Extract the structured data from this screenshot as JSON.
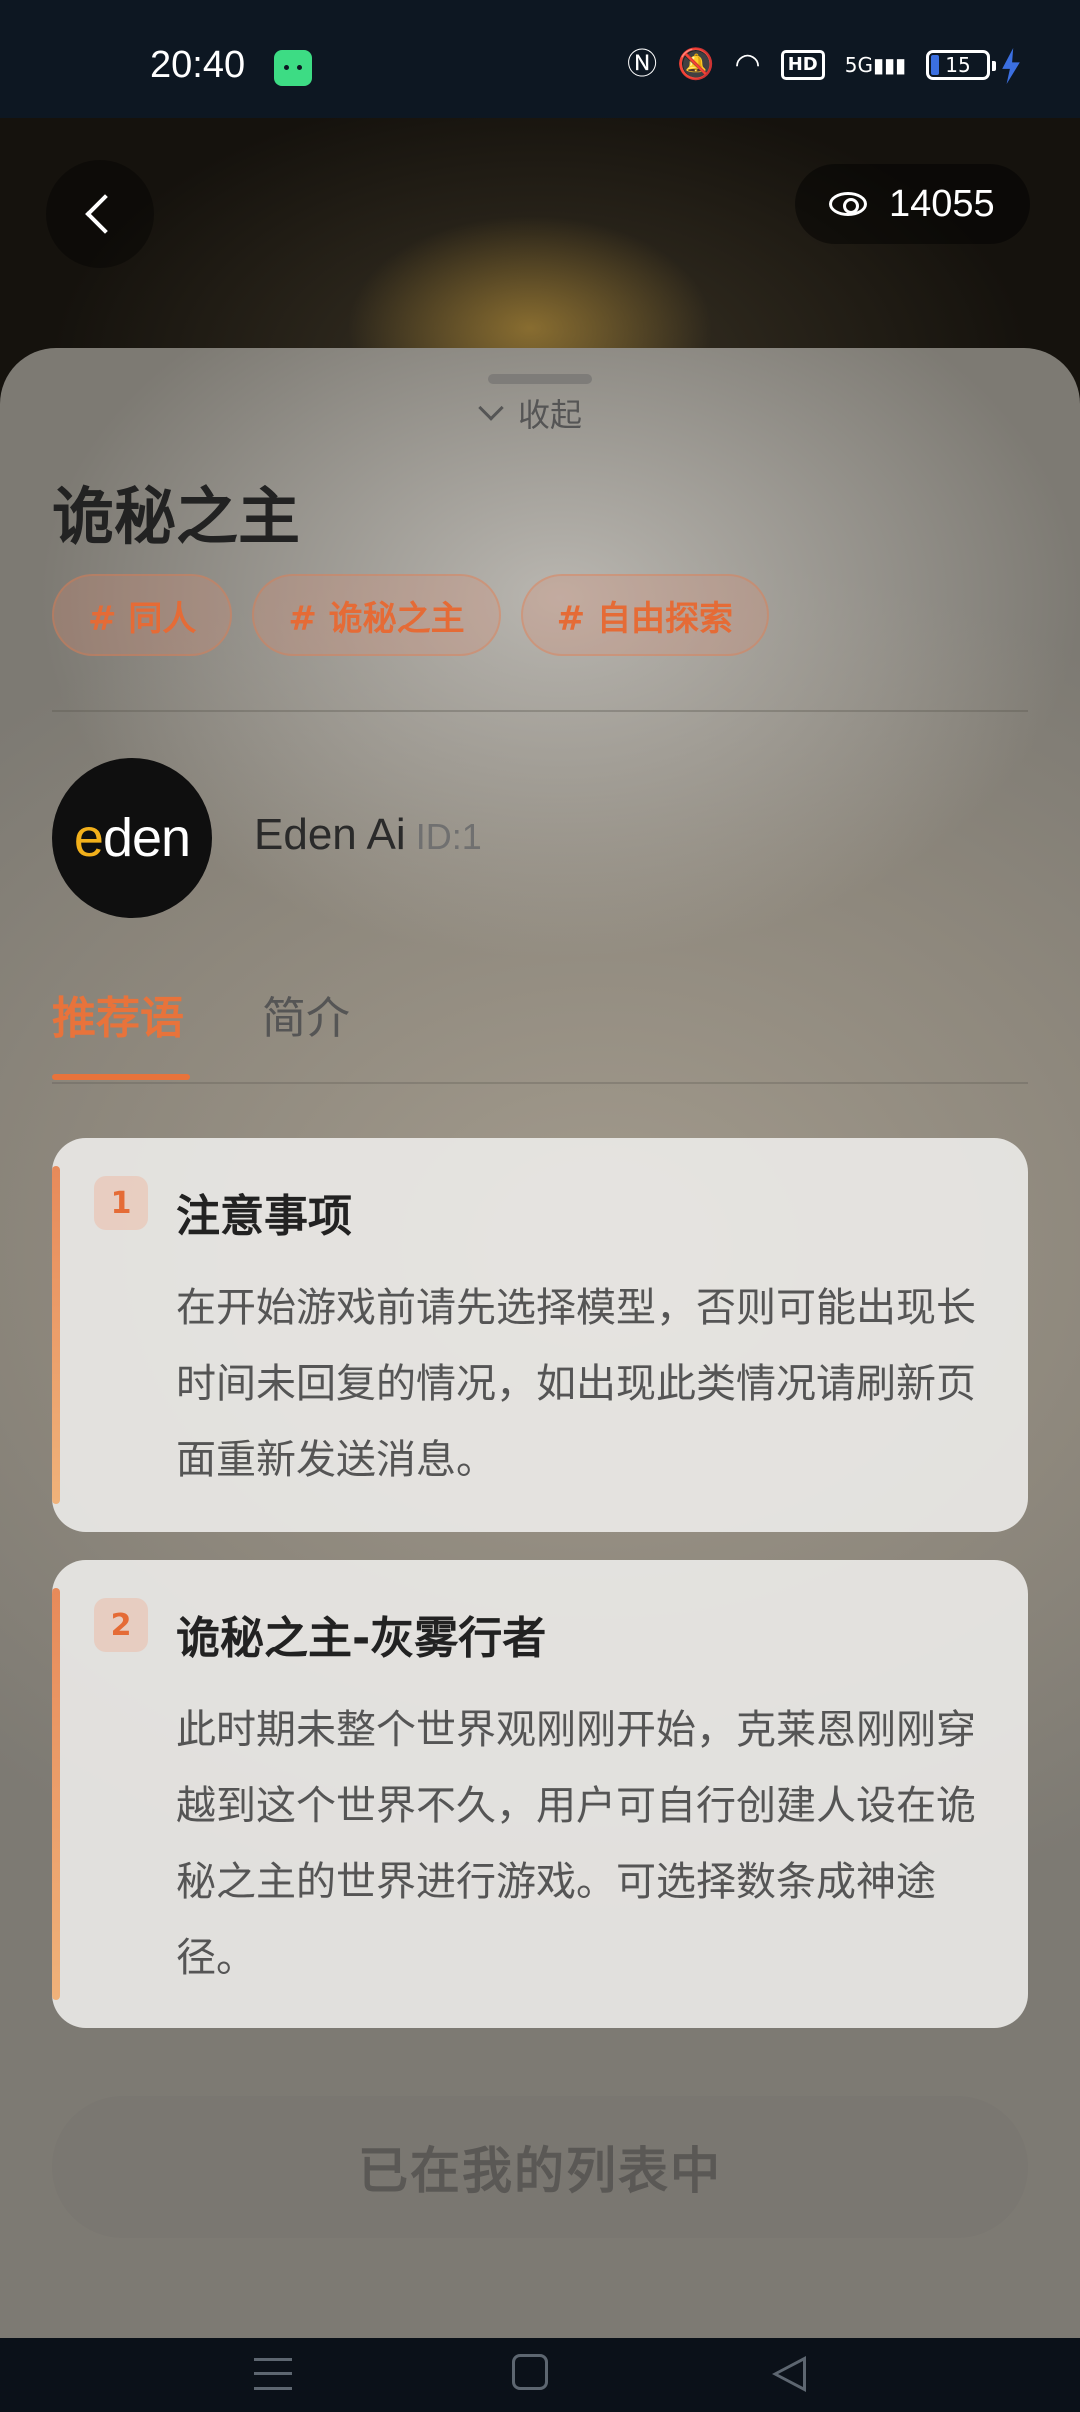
{
  "status_bar": {
    "time": "20:40",
    "network": "5G",
    "hd": "HD",
    "battery": "15",
    "icons": [
      "android-notification-icon",
      "nfc-icon",
      "mute-icon",
      "wifi-icon",
      "hd-icon",
      "signal-icon",
      "battery-icon",
      "charging-icon"
    ]
  },
  "header": {
    "view_count": "14055",
    "icons": [
      "back-arrow-icon",
      "eye-icon"
    ]
  },
  "sheet": {
    "collapse_label": "收起",
    "title": "诡秘之主",
    "tags": [
      "# 同人",
      "# 诡秘之主",
      "# 自由探索"
    ],
    "author": {
      "avatar_text": "eden",
      "name": "Eden Ai",
      "id": "ID:1"
    },
    "tabs": [
      {
        "label": "推荐语",
        "active": true
      },
      {
        "label": "简介",
        "active": false
      }
    ],
    "cards": [
      {
        "number": "1",
        "title": "注意事项",
        "body": "在开始游戏前请先选择模型，否则可能出现长时间未回复的情况，如出现此类情况请刷新页面重新发送消息。"
      },
      {
        "number": "2",
        "title": "诡秘之主-灰雾行者",
        "body": "此时期未整个世界观刚刚开始，克莱恩刚刚穿越到这个世界不久，用户可自行创建人设在诡秘之主的世界进行游戏。可选择数条成神途径。"
      }
    ],
    "list_button": "已在我的列表中"
  },
  "colors": {
    "accent": "#e8733b",
    "tag_text": "#e56b36"
  }
}
